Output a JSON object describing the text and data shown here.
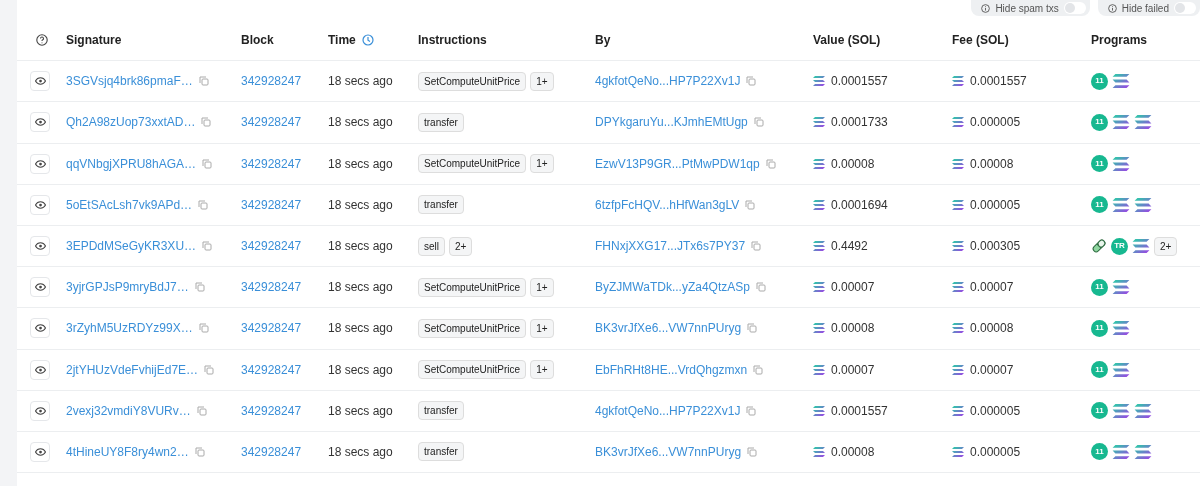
{
  "filters": [
    {
      "label": "Hide spam txs",
      "on": false
    },
    {
      "label": "Hide failed",
      "on": false
    }
  ],
  "table": {
    "columns": [
      "Signature",
      "Block",
      "Time",
      "Instructions",
      "By",
      "Value (SOL)",
      "Fee (SOL)",
      "Programs"
    ],
    "rows": [
      {
        "signature": "3SGVsjq4brk86pmaF…",
        "block": "342928247",
        "time": "18 secs ago",
        "instructions": [
          "SetComputeUnitPrice",
          "1+"
        ],
        "by": "4gkfotQeNo...HP7P22Xv1J",
        "value": "0.0001557",
        "fee": "0.0001557",
        "programs": [
          {
            "kind": "badge",
            "label": "11"
          },
          {
            "kind": "solana"
          }
        ]
      },
      {
        "signature": "Qh2A98zUop73xxtAD…",
        "block": "342928247",
        "time": "18 secs ago",
        "instructions": [
          "transfer"
        ],
        "by": "DPYkgaruYu...KJmhEMtUgp",
        "value": "0.0001733",
        "fee": "0.000005",
        "programs": [
          {
            "kind": "badge",
            "label": "11"
          },
          {
            "kind": "solana"
          },
          {
            "kind": "solana"
          }
        ]
      },
      {
        "signature": "qqVNbgjXPRU8hAGA…",
        "block": "342928247",
        "time": "18 secs ago",
        "instructions": [
          "SetComputeUnitPrice",
          "1+"
        ],
        "by": "EzwV13P9GR...PtMwPDW1qp",
        "value": "0.00008",
        "fee": "0.00008",
        "programs": [
          {
            "kind": "badge",
            "label": "11"
          },
          {
            "kind": "solana"
          }
        ]
      },
      {
        "signature": "5oEtSAcLsh7vk9APd…",
        "block": "342928247",
        "time": "18 secs ago",
        "instructions": [
          "transfer"
        ],
        "by": "6tzfpFcHQV...hHfWan3gLV",
        "value": "0.0001694",
        "fee": "0.000005",
        "programs": [
          {
            "kind": "badge",
            "label": "11"
          },
          {
            "kind": "solana"
          },
          {
            "kind": "solana"
          }
        ]
      },
      {
        "signature": "3EPDdMSeGyKR3XU…",
        "block": "342928247",
        "time": "18 secs ago",
        "instructions": [
          "sell",
          "2+"
        ],
        "by": "FHNxjXXG17...JTx6s7PY37",
        "value": "0.4492",
        "fee": "0.000305",
        "programs": [
          {
            "kind": "pill"
          },
          {
            "kind": "badge",
            "label": "TR"
          },
          {
            "kind": "solana"
          },
          {
            "kind": "more",
            "label": "2+"
          }
        ]
      },
      {
        "signature": "3yjrGPJsP9mryBdJ7…",
        "block": "342928247",
        "time": "18 secs ago",
        "instructions": [
          "SetComputeUnitPrice",
          "1+"
        ],
        "by": "ByZJMWaTDk...yZa4QtzASp",
        "value": "0.00007",
        "fee": "0.00007",
        "programs": [
          {
            "kind": "badge",
            "label": "11"
          },
          {
            "kind": "solana"
          }
        ]
      },
      {
        "signature": "3rZyhM5UzRDYz99X…",
        "block": "342928247",
        "time": "18 secs ago",
        "instructions": [
          "SetComputeUnitPrice",
          "1+"
        ],
        "by": "BK3vrJfXe6...VW7nnPUryg",
        "value": "0.00008",
        "fee": "0.00008",
        "programs": [
          {
            "kind": "badge",
            "label": "11"
          },
          {
            "kind": "solana"
          }
        ]
      },
      {
        "signature": "2jtYHUzVdeFvhijEd7E…",
        "block": "342928247",
        "time": "18 secs ago",
        "instructions": [
          "SetComputeUnitPrice",
          "1+"
        ],
        "by": "EbFhRHt8HE...VrdQhgzmxn",
        "value": "0.00007",
        "fee": "0.00007",
        "programs": [
          {
            "kind": "badge",
            "label": "11"
          },
          {
            "kind": "solana"
          }
        ]
      },
      {
        "signature": "2vexj32vmdiY8VURv…",
        "block": "342928247",
        "time": "18 secs ago",
        "instructions": [
          "transfer"
        ],
        "by": "4gkfotQeNo...HP7P22Xv1J",
        "value": "0.0001557",
        "fee": "0.000005",
        "programs": [
          {
            "kind": "badge",
            "label": "11"
          },
          {
            "kind": "solana"
          },
          {
            "kind": "solana"
          }
        ]
      },
      {
        "signature": "4tHineUY8F8ry4wn2…",
        "block": "342928247",
        "time": "18 secs ago",
        "instructions": [
          "transfer"
        ],
        "by": "BK3vrJfXe6...VW7nnPUryg",
        "value": "0.00008",
        "fee": "0.000005",
        "programs": [
          {
            "kind": "badge",
            "label": "11"
          },
          {
            "kind": "solana"
          },
          {
            "kind": "solana"
          }
        ]
      }
    ]
  }
}
